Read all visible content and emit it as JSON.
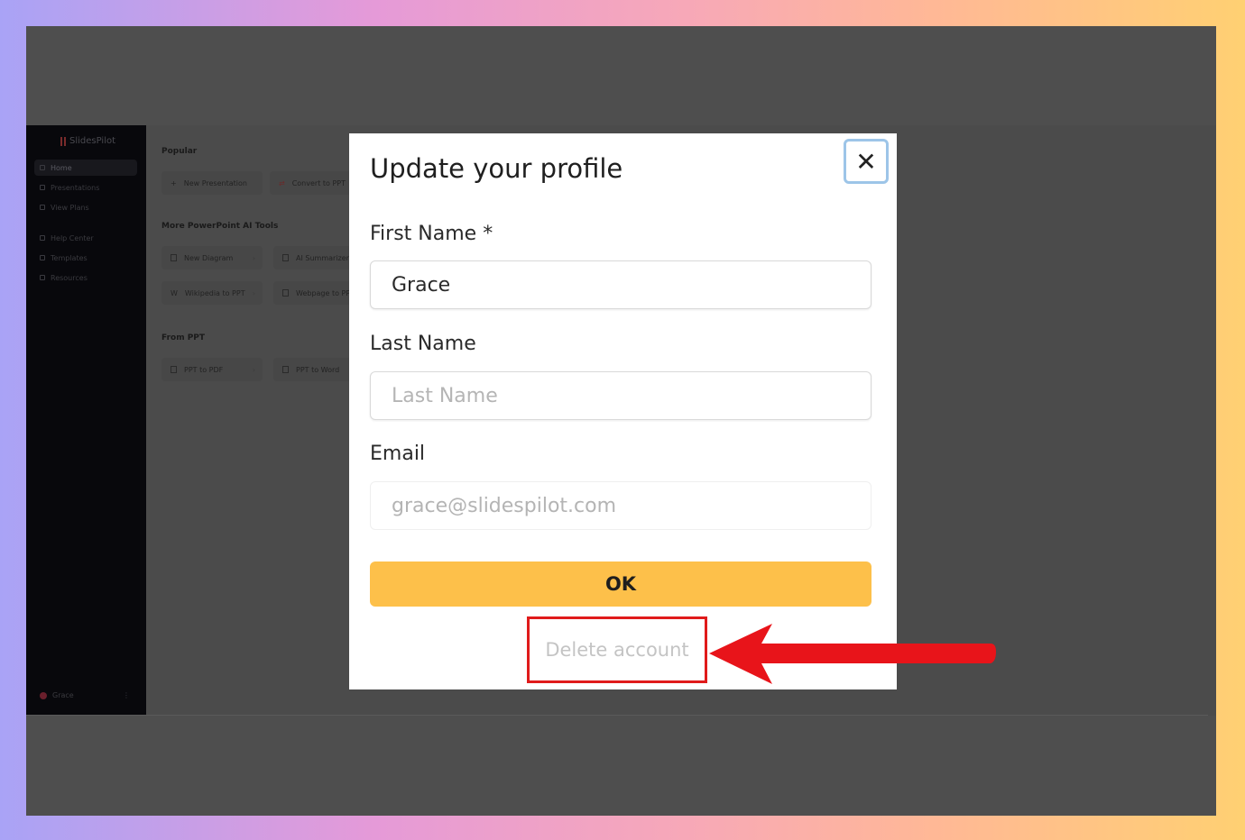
{
  "app": {
    "logo_text": "SlidesPilot",
    "nav": [
      {
        "label": "Home",
        "active": true
      },
      {
        "label": "Presentations"
      },
      {
        "label": "View Plans"
      },
      {
        "label": "Help Center"
      },
      {
        "label": "Templates"
      },
      {
        "label": "Resources"
      }
    ],
    "user_name": "Grace",
    "sections": {
      "popular": "Popular",
      "more_tools": "More PowerPoint AI Tools",
      "from_ppt": "From PPT"
    },
    "tools": {
      "new_presentation": "New Presentation",
      "convert_to_ppt": "Convert to PPT",
      "new_diagram": "New Diagram",
      "ai_summarizer": "AI Summarizer",
      "wikipedia_to_ppt": "Wikipedia to PPT",
      "webpage_to_ppt": "Webpage to PPT",
      "ppt_to_pdf": "PPT to PDF",
      "ppt_to_word": "PPT to Word"
    }
  },
  "modal": {
    "title": "Update your profile",
    "close_symbol": "✕",
    "first_name": {
      "label": "First Name *",
      "value": "Grace"
    },
    "last_name": {
      "label": "Last Name",
      "value": "",
      "placeholder": "Last Name"
    },
    "email": {
      "label": "Email",
      "value": "grace@slidespilot.com"
    },
    "ok_label": "OK",
    "delete_label": "Delete account"
  },
  "annotation": {
    "arrow_color": "#e8141a",
    "highlight_color": "#e01b1b"
  }
}
